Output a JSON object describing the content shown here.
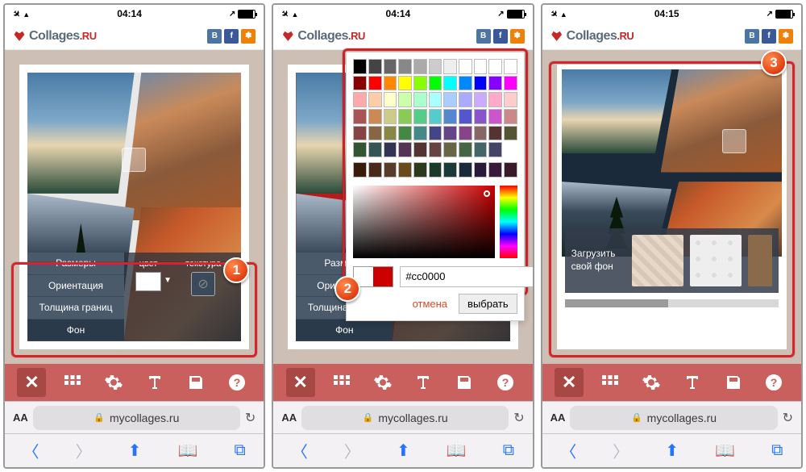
{
  "status": {
    "time1": "04:14",
    "time2": "04:14",
    "time3": "04:15"
  },
  "logo": {
    "text": "Collages",
    "suffix": ".RU"
  },
  "social": {
    "vk": "B",
    "fb": "f",
    "ok": "✽"
  },
  "menu": {
    "items": [
      "Размеры",
      "Ориентация",
      "Толщина границ",
      "Фон"
    ],
    "color_label": "цвет",
    "texture_label": "текстура"
  },
  "picker": {
    "hex": "#cc0000",
    "cancel": "отмена",
    "choose": "выбрать",
    "swatch_colors": [
      "#000",
      "#444",
      "#666",
      "#888",
      "#aaa",
      "#ccc",
      "#eee",
      "#fff",
      "#fff",
      "#fff",
      "#fff",
      "#800",
      "#f00",
      "#f80",
      "#ff0",
      "#8f0",
      "#0f0",
      "#0ff",
      "#08f",
      "#00f",
      "#80f",
      "#f0f",
      "#faa",
      "#fca",
      "#ffc",
      "#cfa",
      "#afc",
      "#aff",
      "#acf",
      "#aaf",
      "#caf",
      "#fac",
      "#fcc",
      "#a55",
      "#c85",
      "#cc8",
      "#8c5",
      "#5c8",
      "#5cc",
      "#58c",
      "#55c",
      "#85c",
      "#c5c",
      "#c88",
      "#844",
      "#864",
      "#884",
      "#484",
      "#488",
      "#448",
      "#648",
      "#848",
      "#866",
      "#533",
      "#553",
      "#353",
      "#355",
      "#335",
      "#535",
      "#533",
      "#644",
      "#664",
      "#464",
      "#466",
      "#446"
    ],
    "swatch_row2": [
      "#3a1a0a",
      "#4a2a1a",
      "#5a3a2a",
      "#6a4a1a",
      "#2a3a1a",
      "#1a3a2a",
      "#1a3a3a",
      "#1a2a3a",
      "#2a1a3a",
      "#3a1a3a",
      "#3a1a2a"
    ]
  },
  "texbar": {
    "upload": "Загрузить свой фон"
  },
  "url": {
    "aa": "AA",
    "domain": "mycollages.ru"
  },
  "badges": {
    "b1": "1",
    "b2": "2",
    "b3": "3"
  }
}
